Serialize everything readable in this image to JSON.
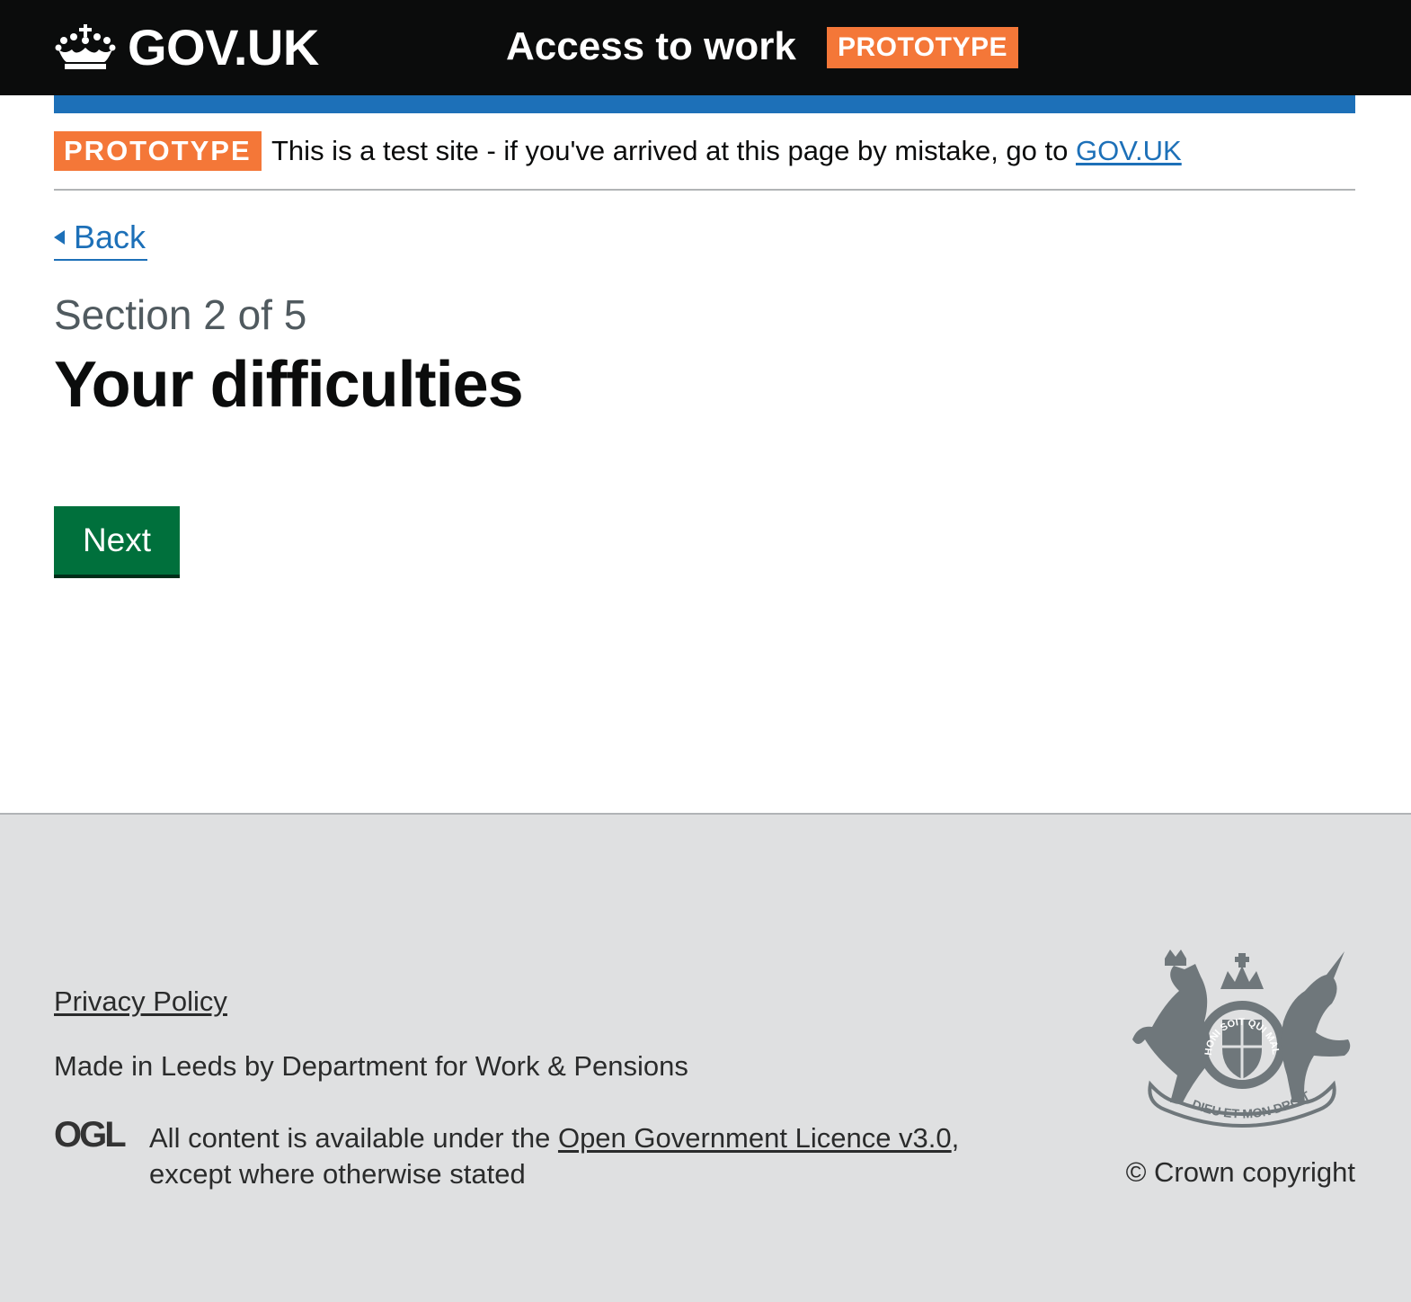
{
  "header": {
    "logo_text": "GOV.UK",
    "service_name": "Access to work",
    "tag": "PROTOTYPE"
  },
  "phase_banner": {
    "tag": "PROTOTYPE",
    "text": "This is a test site - if you've arrived at this page by mistake, go to ",
    "link_text": "GOV.UK"
  },
  "back_link": "Back",
  "caption": "Section 2 of 5",
  "title": "Your difficulties",
  "next_button": "Next",
  "footer": {
    "privacy_link": "Privacy Policy",
    "made_in": "Made in Leeds by Department for Work & Pensions",
    "ogl_logo": "OGL",
    "licence_prefix": "All content is available under the ",
    "licence_link": "Open Government Licence v3.0",
    "licence_suffix": ", except where otherwise stated",
    "crest_motto_top": "HONI SOIT QUI MAL Y PENSE",
    "crest_motto_bottom": "DIEU ET MON DROIT",
    "copyright": "© Crown copyright"
  },
  "colors": {
    "header_bg": "#0b0c0c",
    "brand_blue": "#1d70b8",
    "tag_orange": "#f47738",
    "button_green": "#00703c",
    "footer_bg": "#dfe0e1",
    "caption_grey": "#505a5f"
  }
}
